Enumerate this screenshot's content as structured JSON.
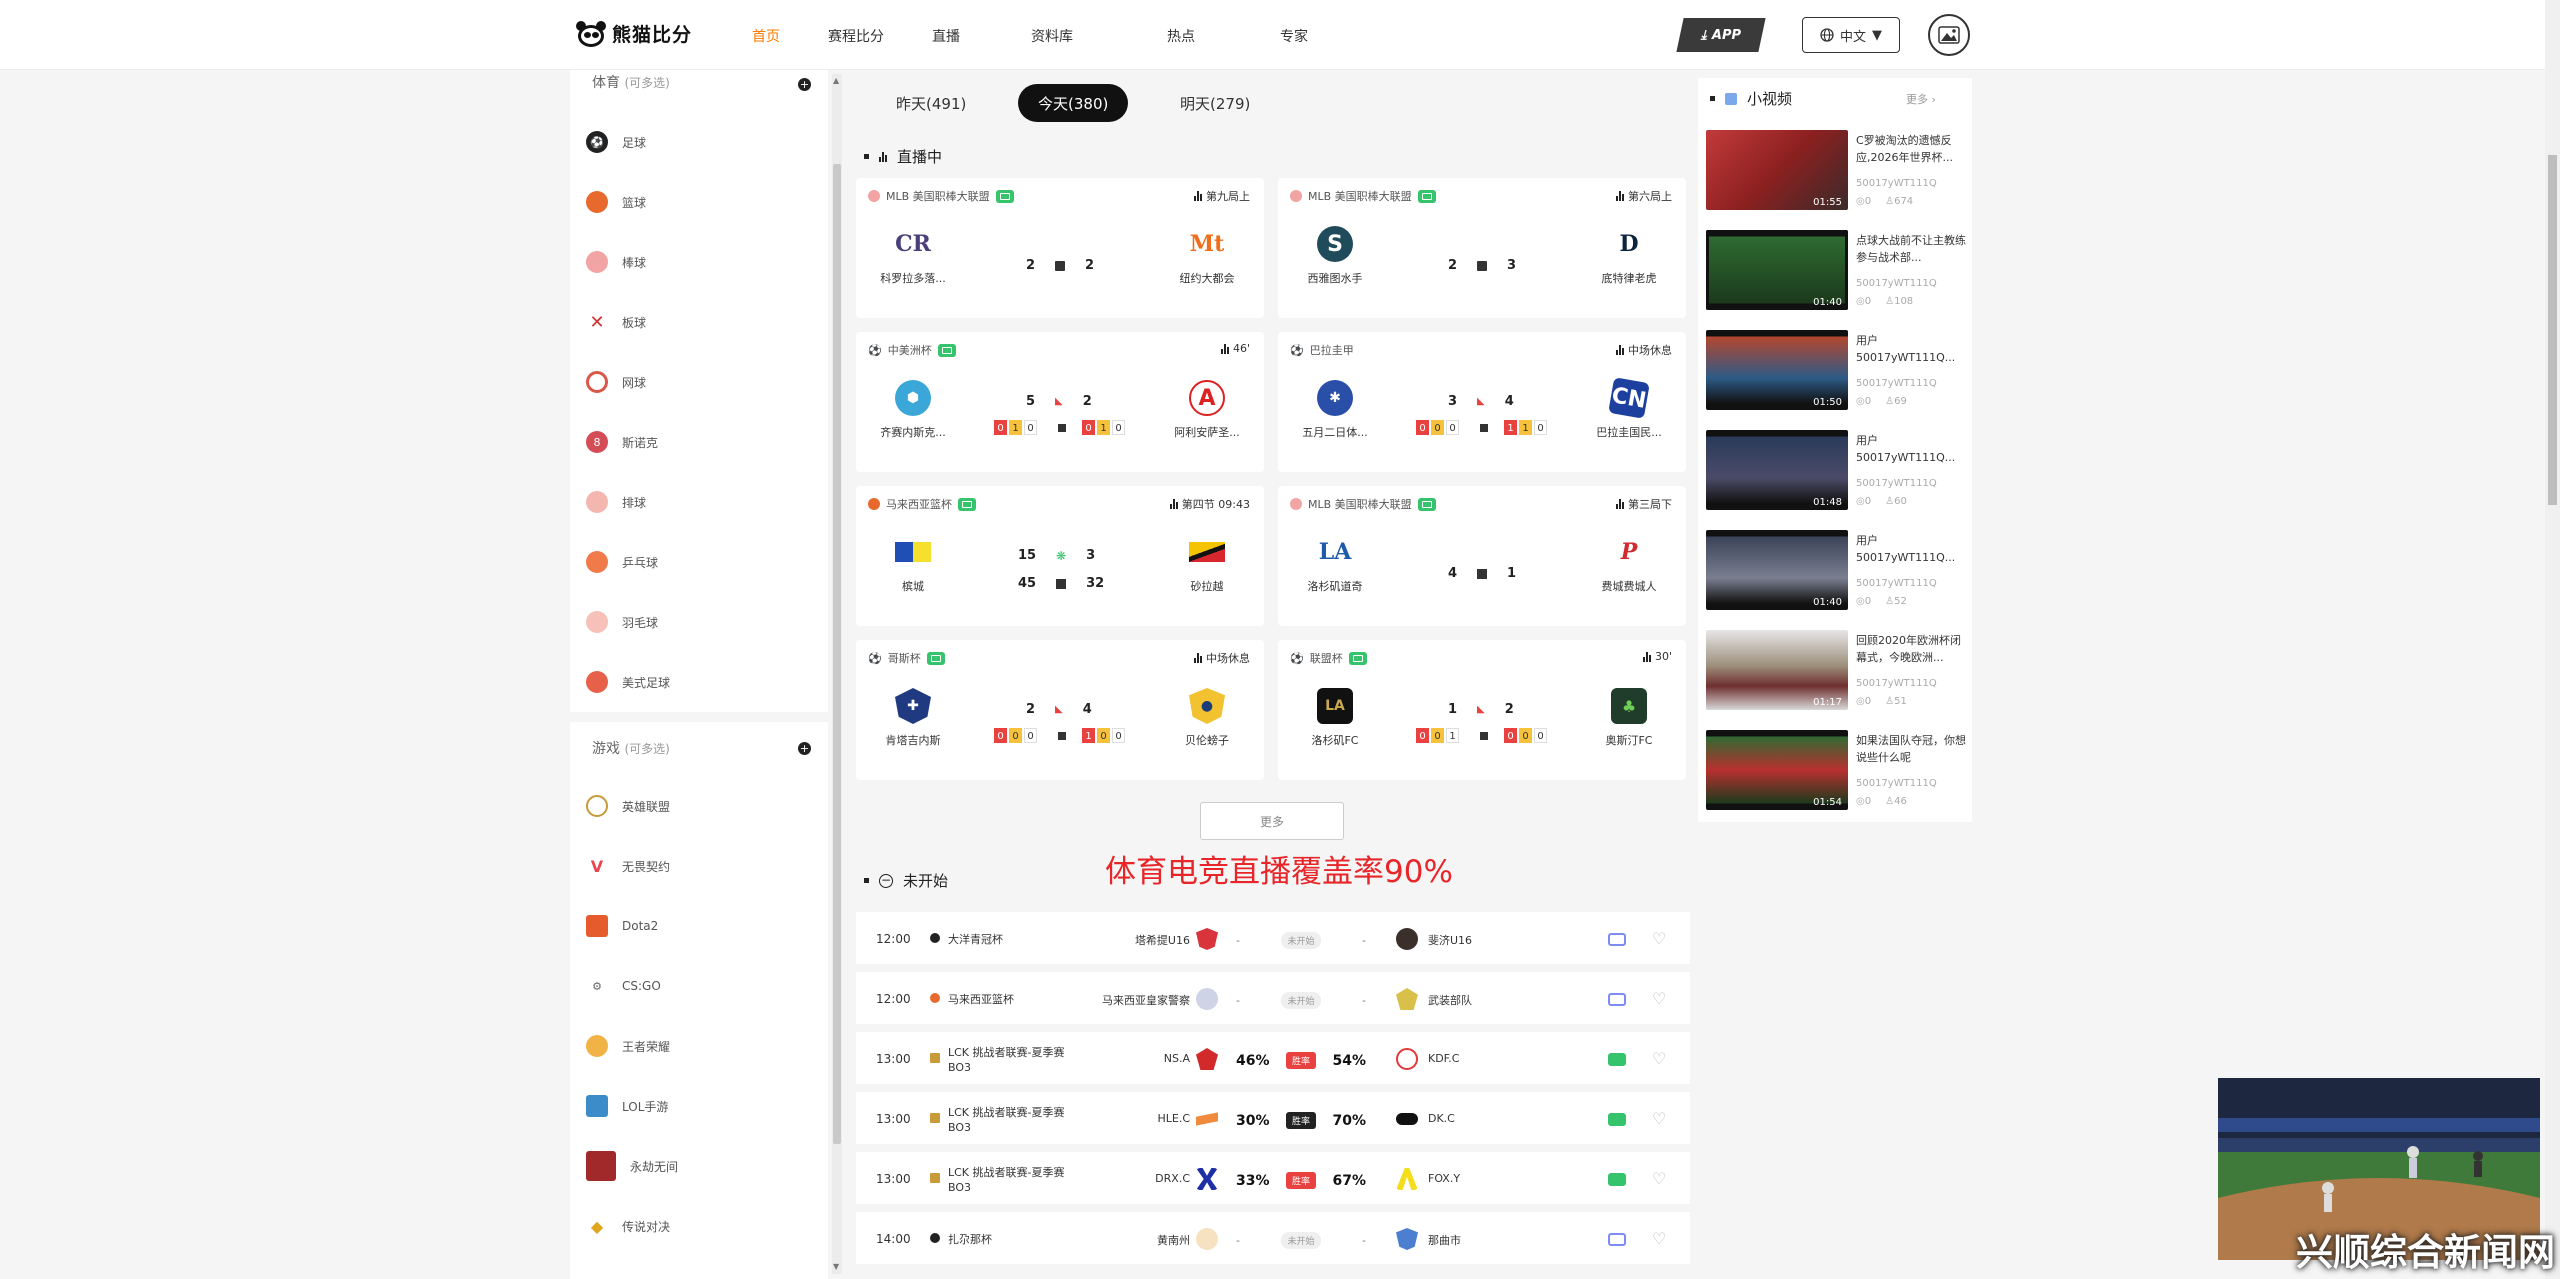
{
  "header": {
    "logo_text": "熊猫比分",
    "nav": [
      "首页",
      "赛程比分",
      "直播",
      "资料库",
      "热点",
      "专家"
    ],
    "active_nav": "首页",
    "app_label": "APP",
    "lang_label": "中文"
  },
  "sidebar": {
    "sports_title": "体育",
    "sports_hint": "(可多选)",
    "sports": [
      "足球",
      "篮球",
      "棒球",
      "板球",
      "网球",
      "斯诺克",
      "排球",
      "乒乓球",
      "羽毛球",
      "美式足球"
    ],
    "games_title": "游戏",
    "games_hint": "(可多选)",
    "games": [
      "英雄联盟",
      "无畏契约",
      "Dota2",
      "CS:GO",
      "王者荣耀",
      "LOL手游",
      "永劫无间",
      "传说对决"
    ]
  },
  "tabs": [
    "昨天(491)",
    "今天(380)",
    "明天(279)"
  ],
  "active_tab": "今天(380)",
  "live_title": "直播中",
  "live_cards": [
    {
      "league": "MLB 美国职棒大联盟",
      "status": "第九局上",
      "home": "科罗拉多落...",
      "away": "纽约大都会",
      "s1": "2",
      "s2": "2"
    },
    {
      "league": "MLB 美国职棒大联盟",
      "status": "第六局上",
      "home": "西雅图水手",
      "away": "底特律老虎",
      "s1": "2",
      "s2": "3"
    },
    {
      "league": "中美洲杯",
      "status": "46'",
      "home": "齐赛内斯克...",
      "away": "阿利安萨圣...",
      "s1": "5",
      "s2": "2",
      "c1": [
        "0",
        "1",
        "0"
      ],
      "c2": [
        "0",
        "1",
        "0"
      ]
    },
    {
      "league": "巴拉圭甲",
      "status": "中场休息",
      "home": "五月二日体...",
      "away": "巴拉圭国民...",
      "s1": "3",
      "s2": "4",
      "c1": [
        "0",
        "0",
        "0"
      ],
      "c2": [
        "1",
        "1",
        "0"
      ]
    },
    {
      "league": "马来西亚篮杯",
      "status": "第四节 09:43",
      "home": "槟城",
      "away": "砂拉越",
      "s1": "15",
      "s2": "3",
      "s3": "45",
      "s4": "32"
    },
    {
      "league": "MLB 美国职棒大联盟",
      "status": "第三局下",
      "home": "洛杉矶道奇",
      "away": "费城费城人",
      "s1": "4",
      "s2": "1"
    },
    {
      "league": "哥斯杯",
      "status": "中场休息",
      "home": "肯塔吉内斯",
      "away": "贝伦螃子",
      "s1": "2",
      "s2": "4",
      "c1": [
        "0",
        "0",
        "0"
      ],
      "c2": [
        "1",
        "0",
        "0"
      ]
    },
    {
      "league": "联盟杯",
      "status": "30'",
      "home": "洛杉矶FC",
      "away": "奥斯汀FC",
      "s1": "1",
      "s2": "2",
      "c1": [
        "0",
        "0",
        "1"
      ],
      "c2": [
        "0",
        "0",
        "0"
      ]
    }
  ],
  "more_label": "更多",
  "promo_text": "体育电竞直播覆盖率90%",
  "upcoming_title": "未开始",
  "upcoming": [
    {
      "time": "12:00",
      "league": "大洋青冠杯",
      "home": "塔希提U16",
      "away": "斐济U16",
      "mid": "未开始",
      "tv": "blue"
    },
    {
      "time": "12:00",
      "league": "马来西亚篮杯",
      "home": "马来西亚皇家警察",
      "away": "武装部队",
      "mid": "未开始",
      "tv": "blue"
    },
    {
      "time": "13:00",
      "league": "LCK 挑战者联赛-夏季赛  BO3",
      "home": "NS.A",
      "away": "KDF.C",
      "hp": "46%",
      "ap": "54%",
      "mid": "胜率",
      "tv": "green"
    },
    {
      "time": "13:00",
      "league": "LCK 挑战者联赛-夏季赛  BO3",
      "home": "HLE.C",
      "away": "DK.C",
      "hp": "30%",
      "ap": "70%",
      "mid": "胜率",
      "tv": "green"
    },
    {
      "time": "13:00",
      "league": "LCK 挑战者联赛-夏季赛  BO3",
      "home": "DRX.C",
      "away": "FOX.Y",
      "hp": "33%",
      "ap": "67%",
      "mid": "胜率",
      "tv": "green"
    },
    {
      "time": "14:00",
      "league": "扎尕那杯",
      "home": "黄南州",
      "away": "那曲市",
      "mid": "未开始",
      "tv": "blue"
    }
  ],
  "videos_title": "小视频",
  "videos_more": "更多",
  "videos": [
    {
      "title": "C罗被淘汰的遗憾反应,2026年世界杯...",
      "user": "50017yWT111Q",
      "views": "0",
      "likes": "674",
      "dur": "01:55"
    },
    {
      "title": "点球大战前不让主教练参与战术部...",
      "user": "50017yWT111Q",
      "views": "0",
      "likes": "108",
      "dur": "01:40"
    },
    {
      "title": "用户50017yWT111Q...",
      "user": "50017yWT111Q",
      "views": "0",
      "likes": "69",
      "dur": "01:50"
    },
    {
      "title": "用户50017yWT111Q...",
      "user": "50017yWT111Q",
      "views": "0",
      "likes": "60",
      "dur": "01:48"
    },
    {
      "title": "用户50017yWT111Q...",
      "user": "50017yWT111Q",
      "views": "0",
      "likes": "52",
      "dur": "01:40"
    },
    {
      "title": "回顾2020年欧洲杯闭幕式，今晚欧洲...",
      "user": "50017yWT111Q",
      "views": "0",
      "likes": "51",
      "dur": "01:17"
    },
    {
      "title": "如果法国队夺冠，你想说些什么呢",
      "user": "50017yWT111Q",
      "views": "0",
      "likes": "46",
      "dur": "01:54"
    }
  ],
  "watermark": "兴顺综合新闻网"
}
